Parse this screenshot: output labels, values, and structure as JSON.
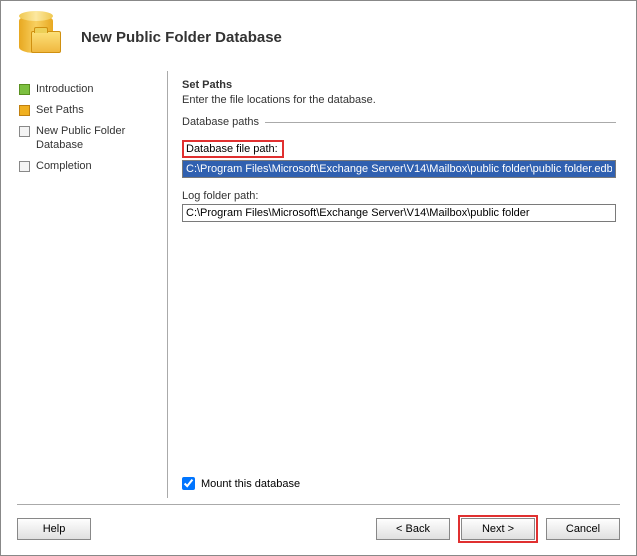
{
  "header": {
    "title": "New Public Folder Database"
  },
  "sidebar": {
    "steps": [
      {
        "label": "Introduction",
        "state": "done"
      },
      {
        "label": "Set Paths",
        "state": "active"
      },
      {
        "label": "New Public Folder Database",
        "state": "pending"
      },
      {
        "label": "Completion",
        "state": "pending"
      }
    ]
  },
  "content": {
    "title": "Set Paths",
    "description": "Enter the file locations for the database.",
    "fieldset_label": "Database paths",
    "db_path_label": "Database file path:",
    "db_path_value": "C:\\Program Files\\Microsoft\\Exchange Server\\V14\\Mailbox\\public folder\\public folder.edb",
    "log_path_label": "Log folder path:",
    "log_path_value": "C:\\Program Files\\Microsoft\\Exchange Server\\V14\\Mailbox\\public folder",
    "mount_label": "Mount this database",
    "mount_checked": true
  },
  "footer": {
    "help": "Help",
    "back": "< Back",
    "next": "Next >",
    "cancel": "Cancel"
  }
}
